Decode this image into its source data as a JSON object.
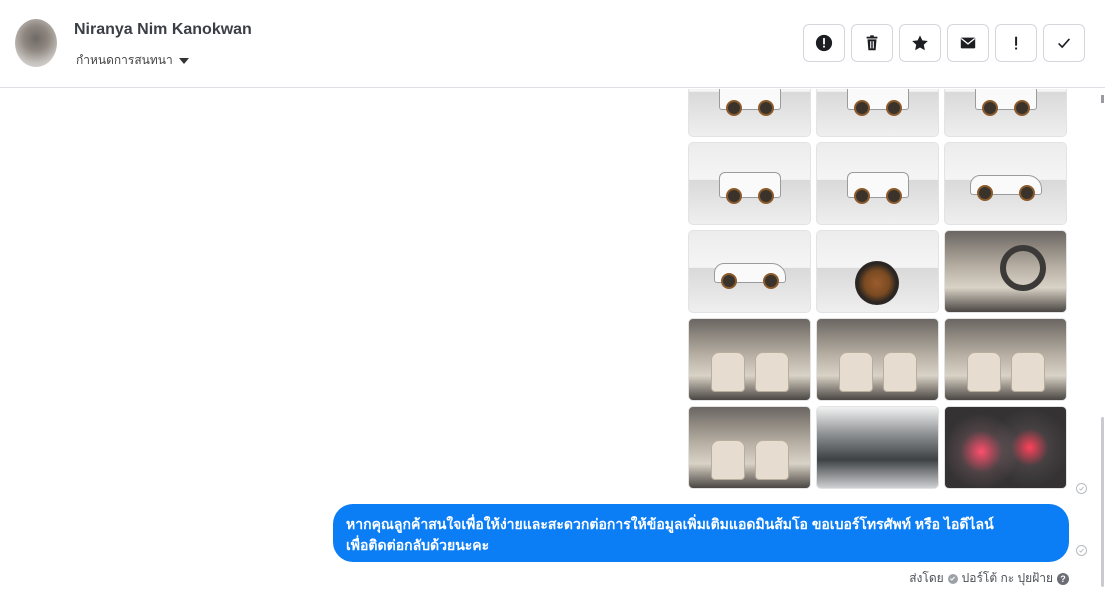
{
  "header": {
    "contact_name": "Niranya Nim Kanokwan",
    "conversation_label": "กำหนดการสนทนา",
    "toolbar": [
      {
        "icon": "alert-circle-icon",
        "name": "mark-spam-button"
      },
      {
        "icon": "trash-icon",
        "name": "delete-button"
      },
      {
        "icon": "star-icon",
        "name": "star-button"
      },
      {
        "icon": "envelope-icon",
        "name": "mark-unread-button"
      },
      {
        "icon": "exclamation-icon",
        "name": "priority-button"
      },
      {
        "icon": "check-icon",
        "name": "done-button"
      }
    ]
  },
  "photos": [
    {
      "kind": "ext",
      "subject": "truck-front"
    },
    {
      "kind": "ext",
      "subject": "truck-front-angle"
    },
    {
      "kind": "ext",
      "subject": "truck-rear-angle"
    },
    {
      "kind": "ext",
      "subject": "truck-rear"
    },
    {
      "kind": "ext",
      "subject": "truck-rear-quarter"
    },
    {
      "kind": "ext",
      "subject": "truck-side-far"
    },
    {
      "kind": "ext",
      "subject": "truck-side"
    },
    {
      "kind": "ext",
      "subject": "wheel"
    },
    {
      "kind": "int",
      "subject": "steering-wheel"
    },
    {
      "kind": "int",
      "subject": "dashboard-interior"
    },
    {
      "kind": "int",
      "subject": "front-seat"
    },
    {
      "kind": "int",
      "subject": "driver-seat"
    },
    {
      "kind": "int",
      "subject": "door-panel"
    },
    {
      "kind": "eng",
      "subject": "engine-bay"
    },
    {
      "kind": "dash",
      "subject": "gauge-cluster"
    }
  ],
  "message": {
    "line1": "หากคุณลูกค้าสนใจเพื่อให้ง่ายและสะดวกต่อการให้ข้อมูลเพิ่มเติมแอดมินส้มโอ ขอเบอร์โทรศัพท์ หรือ ไอดีไลน์",
    "line2": "เพื่อติดต่อกลับด้วยนะคะ",
    "bubble_color": "#0b7df5"
  },
  "sent_by": {
    "prefix": "ส่งโดย",
    "name": "ปอร์โต้ กะ ปุยฝ้าย"
  }
}
